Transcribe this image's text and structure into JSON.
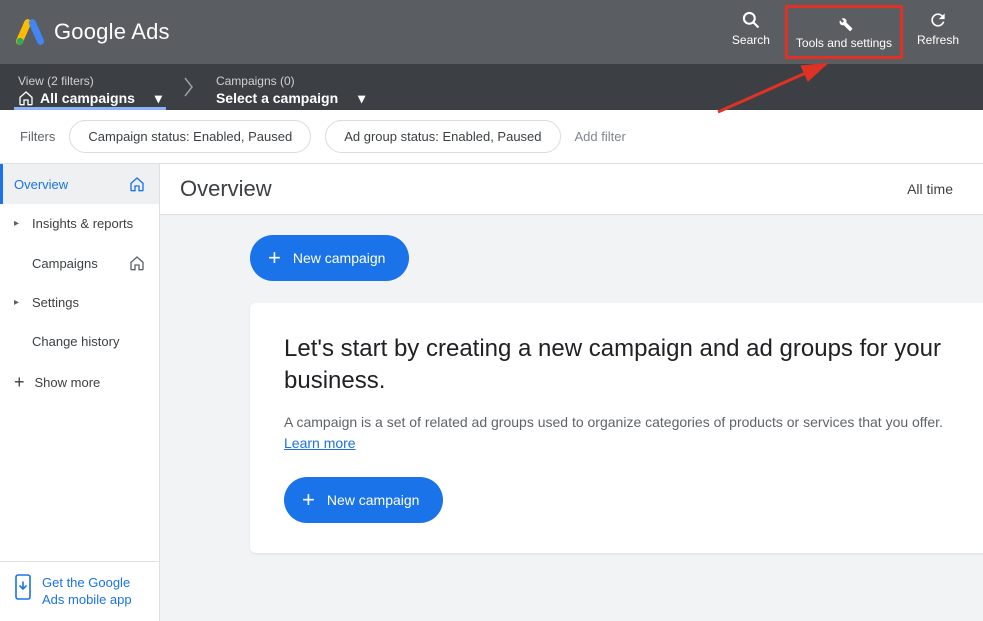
{
  "header": {
    "product_name": "Google Ads",
    "search_label": "Search",
    "tools_label": "Tools and settings",
    "refresh_label": "Refresh"
  },
  "breadcrumb": {
    "view_label": "View (2 filters)",
    "view_value": "All campaigns",
    "campaigns_label": "Campaigns (0)",
    "campaigns_value": "Select a campaign"
  },
  "filters": {
    "label": "Filters",
    "chip1": "Campaign status: Enabled, Paused",
    "chip2": "Ad group status: Enabled, Paused",
    "add": "Add filter"
  },
  "sidebar": {
    "items": [
      {
        "label": "Overview"
      },
      {
        "label": "Insights & reports"
      },
      {
        "label": "Campaigns"
      },
      {
        "label": "Settings"
      },
      {
        "label": "Change history"
      }
    ],
    "show_more": "Show more",
    "app_promo": "Get the Google Ads mobile app"
  },
  "main": {
    "title": "Overview",
    "time_range": "All time",
    "new_campaign": "New campaign",
    "card_heading": "Let's start by creating a new campaign and ad groups for your business.",
    "card_body": "A campaign is a set of related ad groups used to organize categories of products or services that you offer.",
    "learn_more": "Learn more"
  }
}
